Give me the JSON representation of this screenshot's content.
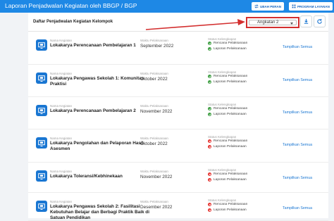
{
  "header": {
    "title": "Laporan Penjadwalan Kegiatan oleh BBGP / BGP",
    "btn_ubah_peran": "UBAH PERAN",
    "btn_program_layanan": "PROGRAM LAYANAN"
  },
  "panel": {
    "title": "Daftar Penjadwalan Kegiatan Kelompok",
    "select_value": "Angkatan 2"
  },
  "labels": {
    "name": "Nama Kegiatan",
    "time": "Waktu Pelaksanaan",
    "status": "Status Kelengkapan",
    "rencana": "Rencana Pelaksanaan",
    "laporan": "Laporan Pelaksanaan",
    "link": "Tampilkan Semua"
  },
  "colors": {
    "accent": "#1e88e5",
    "ok": "#43a047",
    "missing": "#e53935",
    "highlight": "#d32f2f"
  },
  "rows": [
    {
      "name": "Lokakarya Perencanaan Pembelajaran 1",
      "date": "September 2022",
      "rencana": "ok",
      "laporan": "ok"
    },
    {
      "name": "Lokakarya Pengawas Sekolah 1: Komunitas Praktisi",
      "date": "Oktober 2022",
      "rencana": "ok",
      "laporan": "ok"
    },
    {
      "name": "Lokakarya Perencanaan Pembelajaran 2",
      "date": "November 2022",
      "rencana": "ok",
      "laporan": "ok"
    },
    {
      "name": "Lokakarya Pengolahan dan Pelaporan Hasil Asesmen",
      "date": "Oktober 2022",
      "rencana": "missing",
      "laporan": "missing"
    },
    {
      "name": "Lokakarya Toleransi/Kebhinekaan",
      "date": "November 2022",
      "rencana": "missing",
      "laporan": "missing"
    },
    {
      "name": "Lokakarya Pengawas Sekolah 2: Fasilitasi Kebutuhan Belajar dan Berbagi Praktik Baik di Satuan Pendidikan",
      "date": "Desember 2022",
      "rencana": "missing",
      "laporan": "missing"
    }
  ]
}
